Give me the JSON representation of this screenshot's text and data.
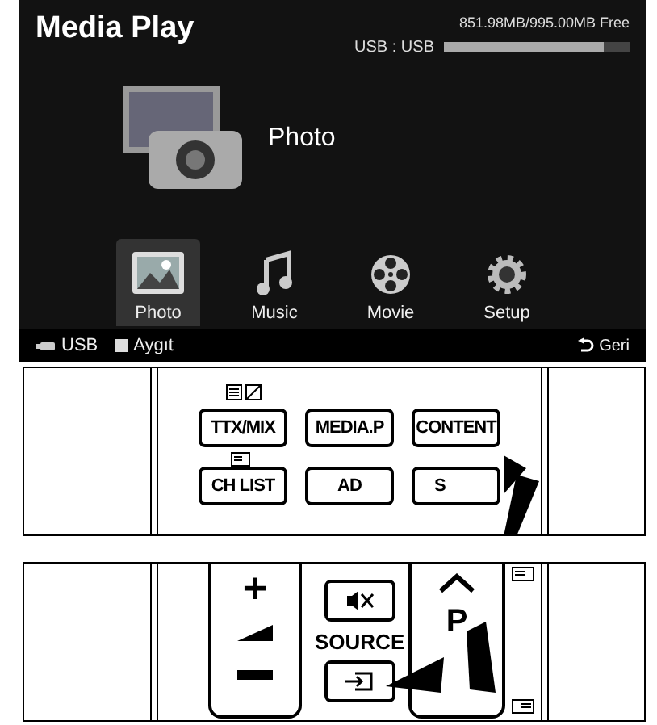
{
  "screen": {
    "title": "Media Play",
    "storage": "851.98MB/995.00MB Free",
    "device": "USB : USB",
    "usage": {
      "level": 0.86
    },
    "focus_label": "Photo",
    "menu": [
      {
        "label": "Photo",
        "kind": "photo",
        "selected": true
      },
      {
        "label": "Music",
        "kind": "music",
        "selected": false
      },
      {
        "label": "Movie",
        "kind": "movie",
        "selected": false
      },
      {
        "label": "Setup",
        "kind": "setup",
        "selected": false
      }
    ],
    "bottom_bar": {
      "left": [
        {
          "label": "USB",
          "kind": "usb"
        },
        {
          "label": "Aygıt",
          "kind": "square"
        }
      ],
      "right": {
        "label": "Geri",
        "kind": "back"
      }
    }
  },
  "remote_top": {
    "rows": [
      [
        "TTX/MIX",
        "MEDIA.P",
        "CONTENT"
      ],
      [
        "CH LIST",
        "AD",
        "S"
      ]
    ]
  },
  "remote_bottom": {
    "source_label": "SOURCE",
    "channel_label": "P",
    "volume_plus": "+"
  }
}
